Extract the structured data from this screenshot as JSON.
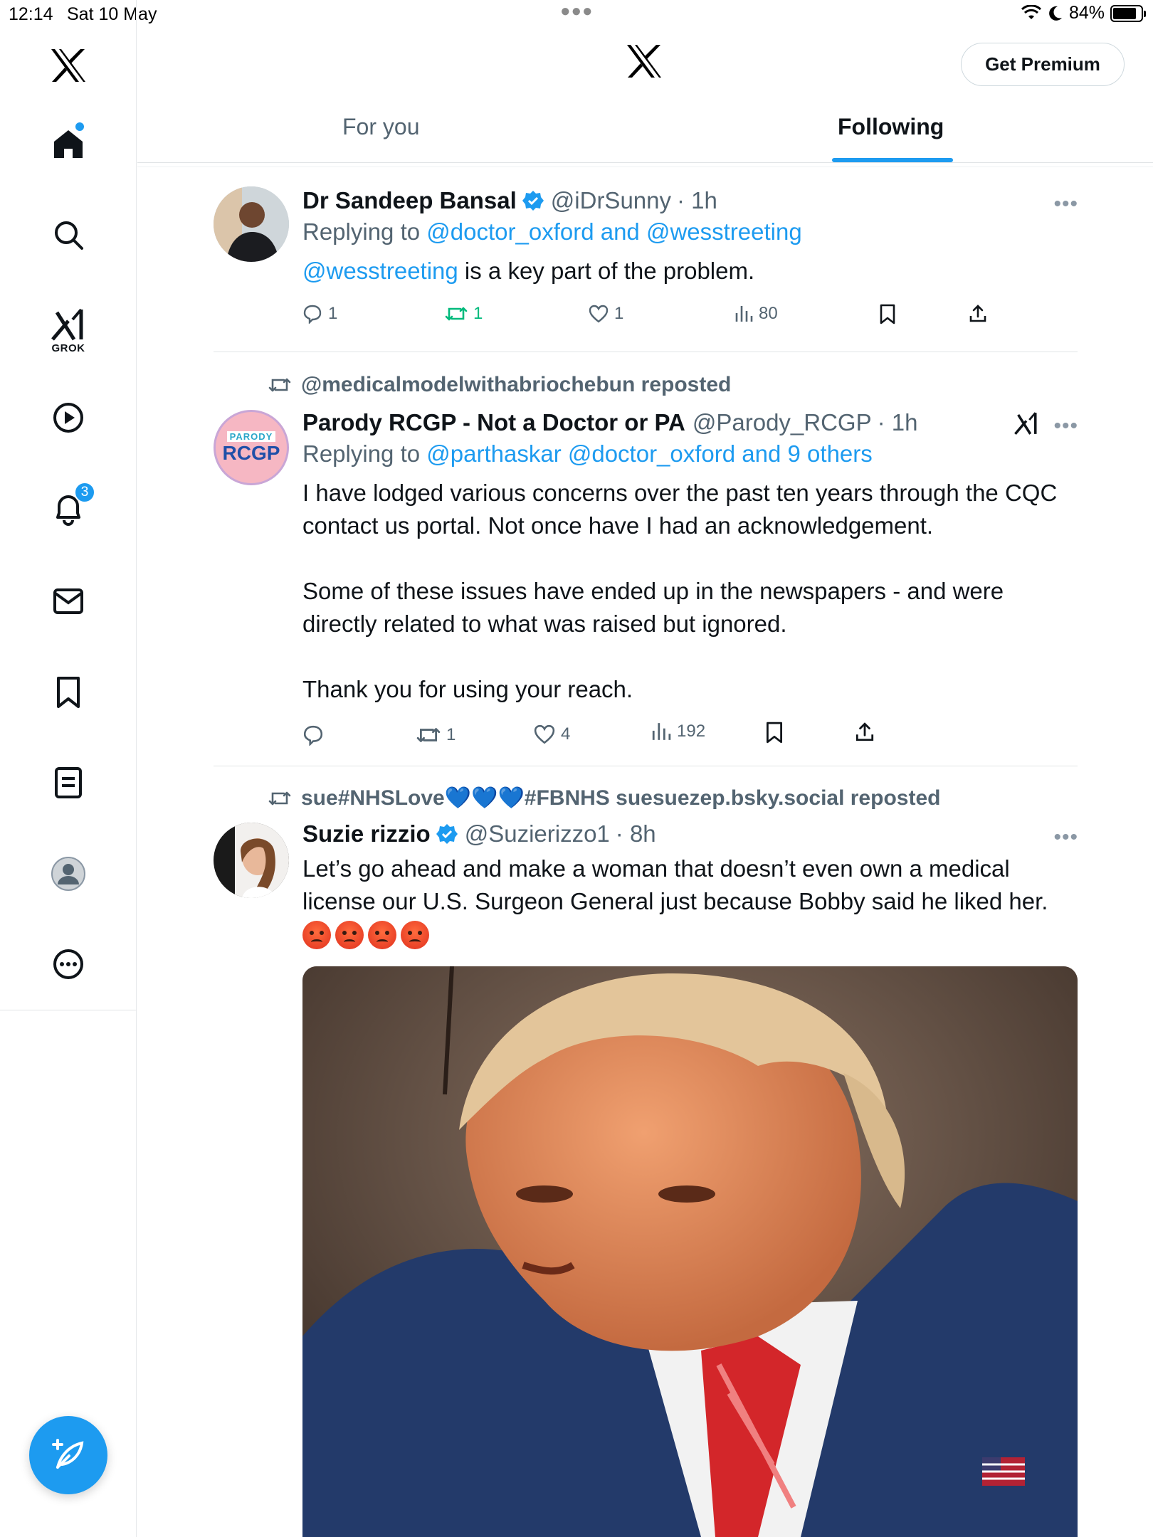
{
  "status_bar": {
    "time": "12:14",
    "date": "Sat 10 May",
    "battery": "84%"
  },
  "sidebar": {
    "grok_label": "GROK",
    "notifications_badge": "3"
  },
  "header": {
    "premium_label": "Get Premium"
  },
  "tabs": [
    {
      "label": "For you",
      "active": false
    },
    {
      "label": "Following",
      "active": true
    }
  ],
  "tweets": [
    {
      "name": "Dr Sandeep Bansal",
      "handle": "@iDrSunny",
      "time": "· 1h",
      "verified": true,
      "reply_prefix": "Replying to ",
      "reply_to": "@doctor_oxford and @wesstreeting",
      "text_mention": "@wesstreeting",
      "text": " is a key part of the problem.",
      "replies": "1",
      "reposts": "1",
      "likes": "1",
      "views": "80"
    },
    {
      "reposted_by": "@medicalmodelwithabriochebun reposted",
      "name": "Parody RCGP - Not a Doctor or PA",
      "handle": "@Parody_RCGP",
      "time": "· 1h",
      "avatar_top": "PARODY",
      "avatar_main": "RCGP",
      "reply_prefix": "Replying to ",
      "reply_to": "@parthaskar @doctor_oxford and 9 others",
      "text": "I have lodged various concerns over the past ten years through the CQC contact us portal. Not once have I had an acknowledgement.\n\nSome of these issues have ended up in the newspapers - and were directly related to what was raised but ignored.\n\nThank you for using your reach.",
      "replies": "",
      "reposts": "1",
      "likes": "4",
      "views": "192"
    },
    {
      "reposted_by": "sue#NHSLove💙💙💙#FBNHS suesuezep.bsky.social reposted",
      "name": "Suzie rizzio",
      "handle": "@Suzierizzo1",
      "time": "· 8h",
      "verified": true,
      "text": "Let’s go ahead and make a woman that doesn’t even own a medical license our U.S. Surgeon General just because Bobby said he liked her."
    }
  ],
  "colors": {
    "accent": "#1d9bf0",
    "repost_green": "#00ba7c",
    "muted": "#536471"
  },
  "icons": [
    "x-logo-icon",
    "home-icon",
    "search-icon",
    "grok-icon",
    "video-icon",
    "bell-icon",
    "mail-icon",
    "bookmark-icon",
    "lists-icon",
    "profile-icon",
    "more-icon",
    "compose-icon",
    "reply-icon",
    "repost-icon",
    "like-icon",
    "views-icon",
    "share-icon",
    "verified-icon"
  ]
}
